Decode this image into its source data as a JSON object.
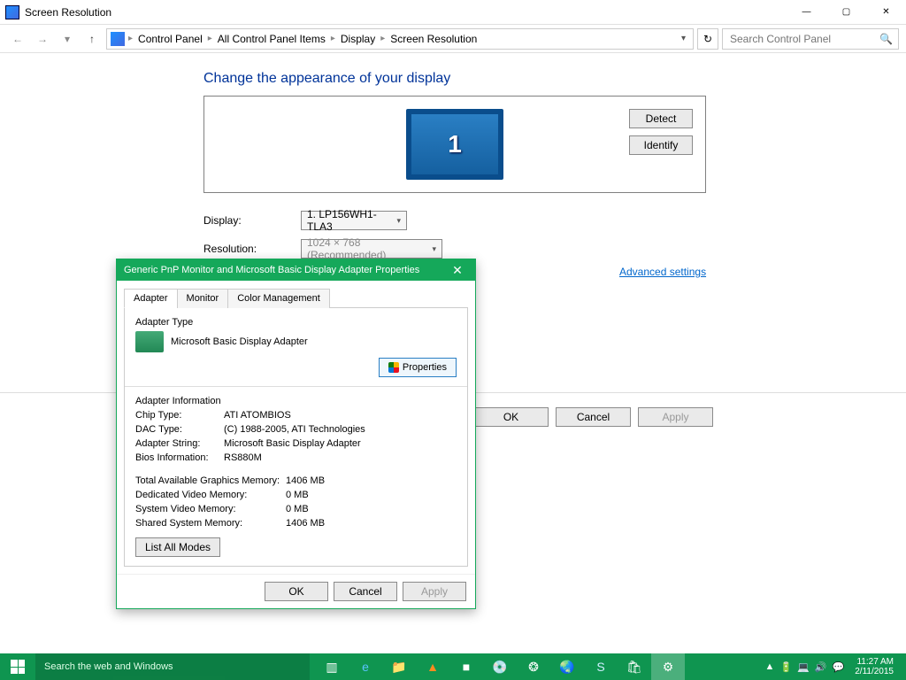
{
  "window": {
    "title": "Screen Resolution"
  },
  "nav": {
    "crumbs": [
      "Control Panel",
      "All Control Panel Items",
      "Display",
      "Screen Resolution"
    ],
    "search_placeholder": "Search Control Panel"
  },
  "main": {
    "heading": "Change the appearance of your display",
    "detect": "Detect",
    "identify": "Identify",
    "monitor_number": "1",
    "rows": {
      "display_label": "Display:",
      "display_value": "1. LP156WH1-TLA3",
      "resolution_label": "Resolution:",
      "resolution_value": "1024 × 768 (Recommended)"
    },
    "advanced": "Advanced settings",
    "ok": "OK",
    "cancel": "Cancel",
    "apply": "Apply"
  },
  "dialog": {
    "title": "Generic PnP Monitor and Microsoft Basic Display Adapter Properties",
    "tabs": {
      "adapter": "Adapter",
      "monitor": "Monitor",
      "color": "Color Management"
    },
    "adapter_type": "Adapter Type",
    "adapter_name": "Microsoft Basic Display Adapter",
    "properties_btn": "Properties",
    "adapter_info": "Adapter Information",
    "chip_type_l": "Chip Type:",
    "chip_type_v": "ATI ATOMBIOS",
    "dac_type_l": "DAC Type:",
    "dac_type_v": "(C) 1988-2005, ATI Technologies",
    "adapter_string_l": "Adapter String:",
    "adapter_string_v": "Microsoft Basic Display Adapter",
    "bios_l": "Bios Information:",
    "bios_v": "RS880M",
    "total_mem_l": "Total Available Graphics Memory:",
    "total_mem_v": "1406 MB",
    "dedicated_l": "Dedicated Video Memory:",
    "dedicated_v": "0 MB",
    "system_l": "System Video Memory:",
    "system_v": "0 MB",
    "shared_l": "Shared System Memory:",
    "shared_v": "1406 MB",
    "list_modes": "List All Modes",
    "ok": "OK",
    "cancel": "Cancel",
    "apply": "Apply"
  },
  "taskbar": {
    "search_placeholder": "Search the web and Windows",
    "time": "11:27 AM",
    "date": "2/11/2015"
  }
}
